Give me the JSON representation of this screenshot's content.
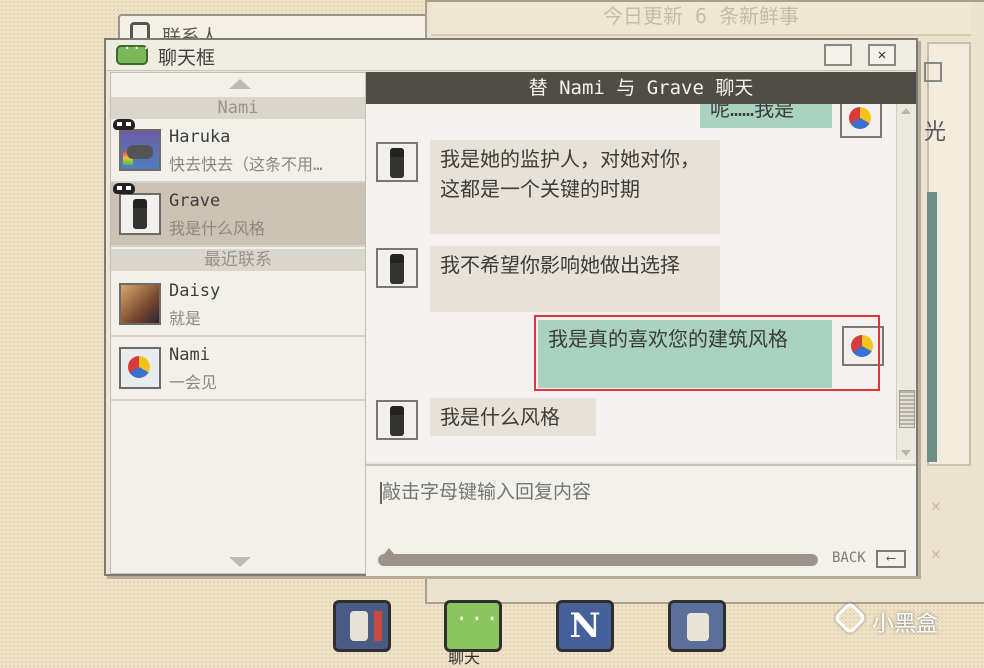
{
  "background": {
    "contacts_window_label": "联系人",
    "news_banner": "今日更新 6 条新鲜事",
    "side_text": "光"
  },
  "window": {
    "title": "聊天框",
    "close_label": "✕"
  },
  "contacts": {
    "section_top": "Nami",
    "section_recent": "最近联系",
    "items": [
      {
        "name": "Haruka",
        "preview": "快去快去（这条不用…",
        "avatar": "haruka-avatar",
        "masked": true
      },
      {
        "name": "Grave",
        "preview": "我是什么风格",
        "avatar": "grave-avatar",
        "masked": true,
        "selected": true
      },
      {
        "name": "Daisy",
        "preview": "就是",
        "avatar": "daisy-avatar"
      },
      {
        "name": "Nami",
        "preview": "一会见",
        "avatar": "nami-avatar"
      }
    ]
  },
  "chat": {
    "header": "替 Nami 与 Grave 聊天",
    "messages": [
      {
        "from": "Nami",
        "direction": "out",
        "text": "呢……我是"
      },
      {
        "from": "Grave",
        "direction": "in",
        "text": "我是她的监护人，对她对你，这都是一个关键的时期"
      },
      {
        "from": "Grave",
        "direction": "in",
        "text": "我不希望你影响她做出选择"
      },
      {
        "from": "Nami",
        "direction": "out",
        "text": "我是真的喜欢您的建筑风格",
        "highlighted": true
      },
      {
        "from": "Grave",
        "direction": "in",
        "text": "我是什么风格"
      }
    ]
  },
  "input": {
    "placeholder": "敲击字母键输入回复内容",
    "back_label": "BACK",
    "back_icon": "⟵"
  },
  "dock": {
    "active_label": "聊天",
    "news_letter": "N",
    "icons": [
      "contacts-book-icon",
      "chat-bubble-icon",
      "news-icon",
      "exit-runner-icon"
    ]
  },
  "watermark": {
    "text": "小黑盒"
  },
  "colors": {
    "outgoing_bubble": "#a9d2c3",
    "incoming_bubble": "#e6e2d9",
    "header_bar": "#4f4d48",
    "highlight_box": "#e0343c"
  }
}
